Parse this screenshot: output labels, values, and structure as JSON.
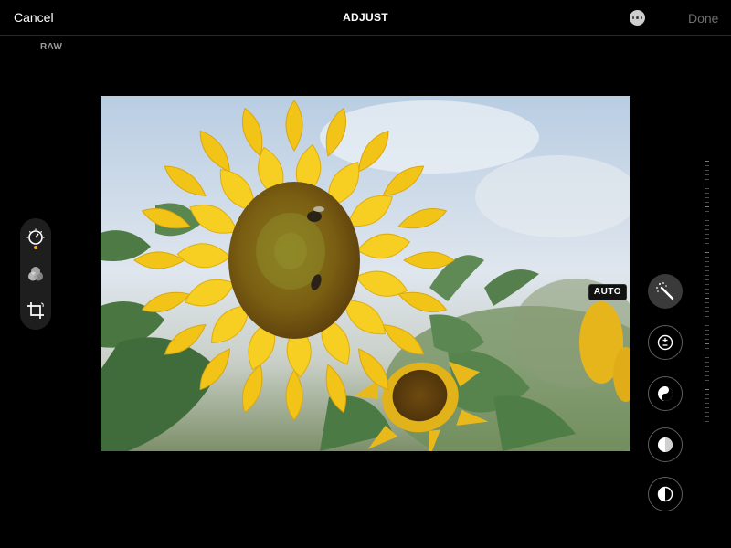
{
  "header": {
    "cancel_label": "Cancel",
    "title": "ADJUST",
    "done_label": "Done"
  },
  "raw_label": "RAW",
  "auto_label": "AUTO",
  "tools": [
    {
      "name": "adjust-tool",
      "icon": "dial-icon",
      "selected": true
    },
    {
      "name": "filters-tool",
      "icon": "filters-icon",
      "selected": false
    },
    {
      "name": "crop-tool",
      "icon": "crop-icon",
      "selected": false
    }
  ],
  "adjustments": [
    {
      "name": "auto-enhance",
      "icon": "magic-wand-icon",
      "active": true
    },
    {
      "name": "exposure",
      "icon": "exposure-icon",
      "active": false
    },
    {
      "name": "brilliance",
      "icon": "brilliance-icon",
      "active": false
    },
    {
      "name": "highlights",
      "icon": "highlights-icon",
      "active": false
    },
    {
      "name": "shadows",
      "icon": "shadows-icon",
      "active": false
    }
  ],
  "colors": {
    "accent": "#f4b400",
    "background": "#000000",
    "done_disabled": "#6e6e6e"
  }
}
